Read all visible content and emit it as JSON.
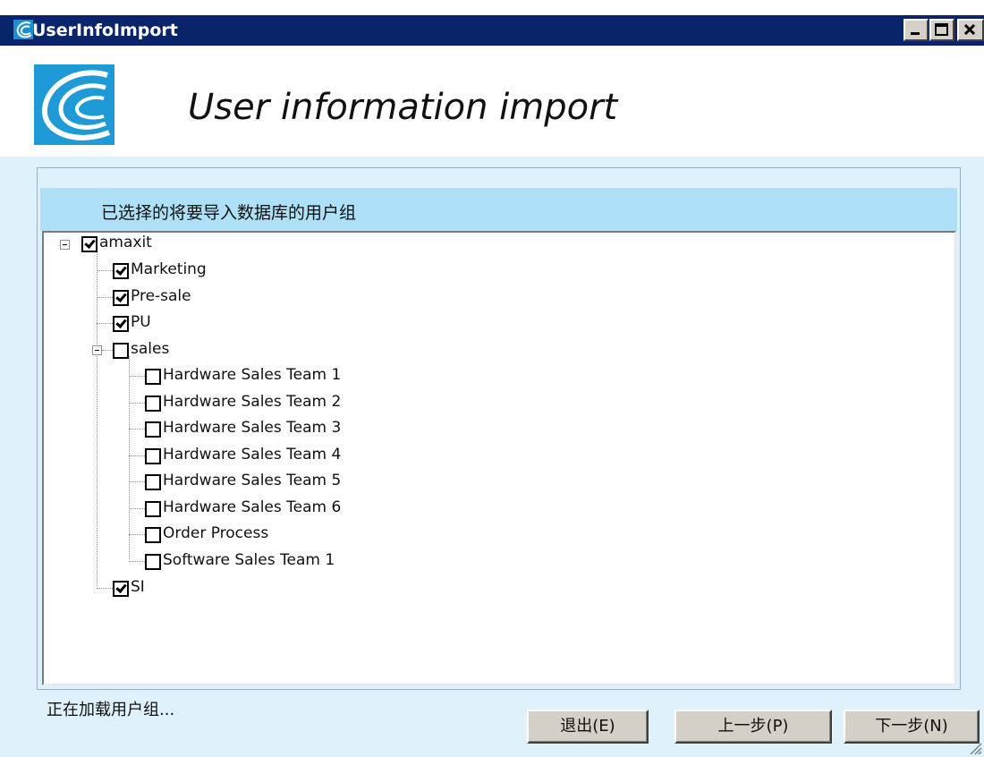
{
  "window": {
    "title": "UserInfoImport",
    "controls": {
      "minimize": "minimize",
      "maximize": "maximize",
      "close": "close"
    }
  },
  "header": {
    "title": "User information import",
    "logo": "company-logo"
  },
  "group": {
    "label": "已选择的将要导入数据库的用户组"
  },
  "tree": {
    "root": {
      "label": "amaxit",
      "checked": true
    },
    "nodes": [
      {
        "label": "Marketing",
        "checked": true
      },
      {
        "label": "Pre-sale",
        "checked": true
      },
      {
        "label": "PU",
        "checked": true
      },
      {
        "label": "sales",
        "checked": false
      },
      {
        "label": "Hardware Sales Team 1",
        "checked": false
      },
      {
        "label": "Hardware Sales Team 2",
        "checked": false
      },
      {
        "label": "Hardware Sales Team 3",
        "checked": false
      },
      {
        "label": "Hardware Sales Team 4",
        "checked": false
      },
      {
        "label": "Hardware Sales Team 5",
        "checked": false
      },
      {
        "label": "Hardware Sales Team 6",
        "checked": false
      },
      {
        "label": "Order Process",
        "checked": false
      },
      {
        "label": "Software Sales Team 1",
        "checked": false
      },
      {
        "label": "SI",
        "checked": true
      }
    ]
  },
  "status": {
    "text": "正在加载用户组..."
  },
  "buttons": {
    "exit": "退出(E)",
    "back": "上一步(P)",
    "next": "下一步(N)"
  },
  "colors": {
    "titlebar": "#0a246a",
    "header_band": "#aee0f8",
    "window_bg": "#dff2fb"
  }
}
